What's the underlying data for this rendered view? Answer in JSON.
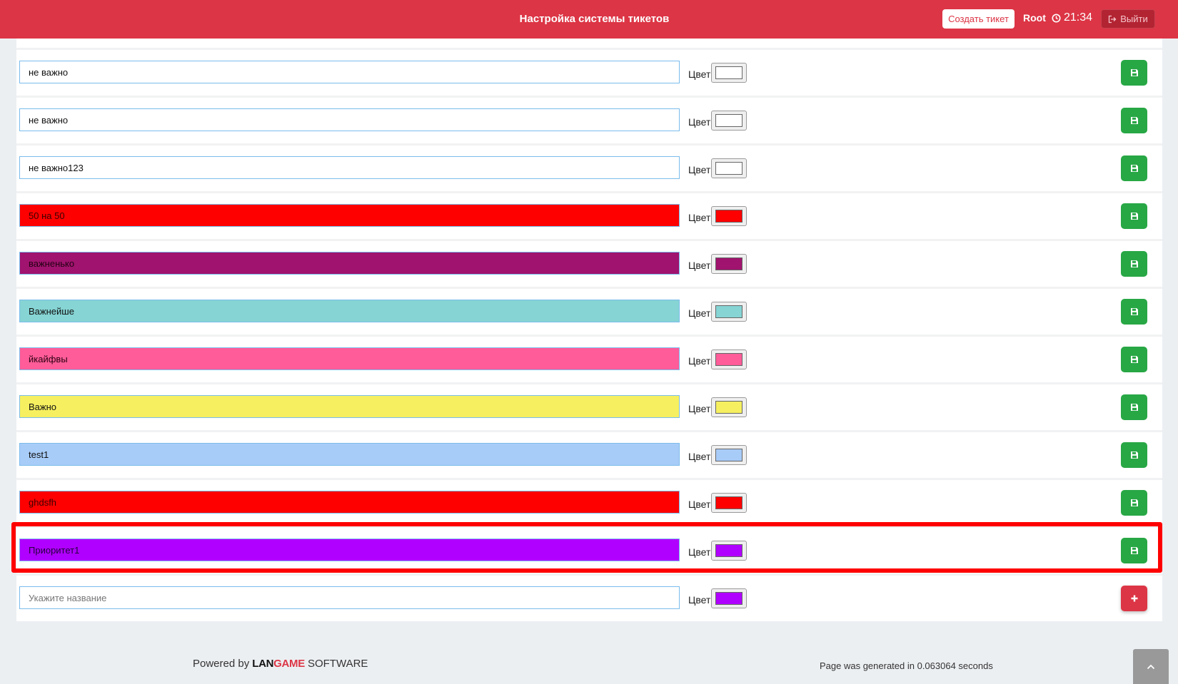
{
  "header": {
    "title": "Настройка системы тикетов",
    "create_ticket_label": "Создать тикет",
    "user": "Root",
    "time": "21:34",
    "logout_label": "Выйти",
    "brand_color": "#dc3545"
  },
  "priorities": [
    {
      "name": "не важно",
      "color_label": "Цвет",
      "color": "#ffffff",
      "text_color": "#111111"
    },
    {
      "name": "не важно",
      "color_label": "Цвет",
      "color": "#ffffff",
      "text_color": "#111111"
    },
    {
      "name": "не важно123",
      "color_label": "Цвет",
      "color": "#ffffff",
      "text_color": "#111111"
    },
    {
      "name": "50 на 50",
      "color_label": "Цвет",
      "color": "#ff0000",
      "text_color": "#3a0000"
    },
    {
      "name": "важненько",
      "color_label": "Цвет",
      "color": "#a0136e",
      "text_color": "#230014"
    },
    {
      "name": "Важнейше",
      "color_label": "Цвет",
      "color": "#86d4d4",
      "text_color": "#111111"
    },
    {
      "name": "йкайфвы",
      "color_label": "Цвет",
      "color": "#ff5c99",
      "text_color": "#2a0010"
    },
    {
      "name": "Важно",
      "color_label": "Цвет",
      "color": "#f6f060",
      "text_color": "#111111"
    },
    {
      "name": "test1",
      "color_label": "Цвет",
      "color": "#a8ccf8",
      "text_color": "#111111"
    },
    {
      "name": "ghdsfh",
      "color_label": "Цвет",
      "color": "#ff0000",
      "text_color": "#3a0000"
    },
    {
      "name": "Приоритет1",
      "color_label": "Цвет",
      "color": "#b000ff",
      "text_color": "#24003a"
    }
  ],
  "new_priority": {
    "placeholder": "Укажите название",
    "color_label": "Цвет",
    "color": "#b000ff"
  },
  "icons": {
    "save": "floppy-disk-icon",
    "add": "plus-icon",
    "clock": "clock-icon",
    "logout": "sign-out-icon",
    "scroll_top": "chevron-up-icon"
  },
  "footer": {
    "powered_by": "Powered by",
    "brand_lan": "LAN",
    "brand_game": "GAME",
    "software": "SOFTWARE",
    "generated": "Page was generated in 0.063064 seconds"
  }
}
